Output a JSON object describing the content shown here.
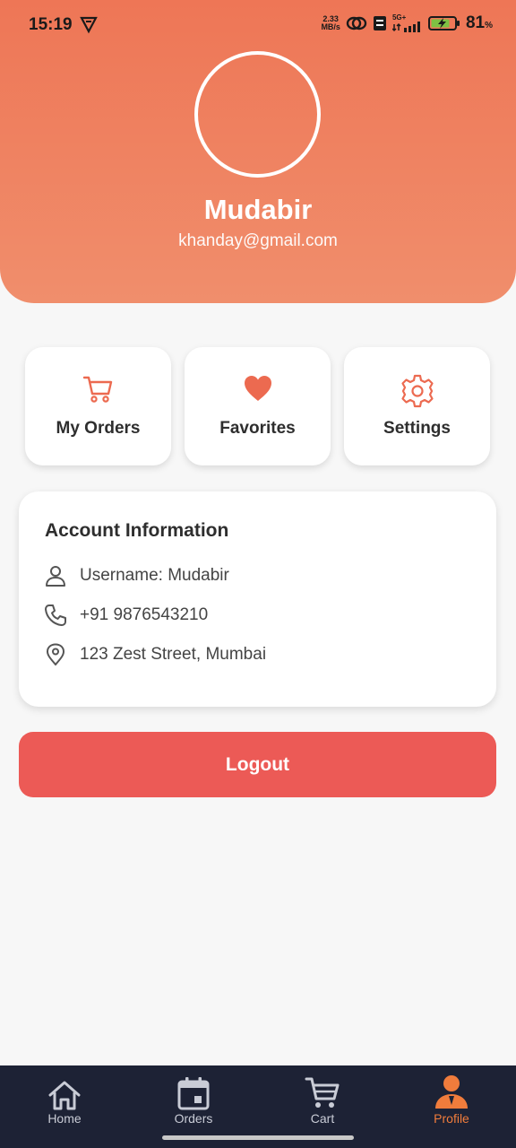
{
  "status_bar": {
    "time": "15:19",
    "net_speed_value": "2.33",
    "net_speed_unit": "MB/s",
    "network": "5G+",
    "battery_percent": "81",
    "battery_unit": "%"
  },
  "profile": {
    "name": "Mudabir",
    "email": "khanday@gmail.com"
  },
  "actions": [
    {
      "label": "My Orders",
      "icon": "cart-icon"
    },
    {
      "label": "Favorites",
      "icon": "heart-icon"
    },
    {
      "label": "Settings",
      "icon": "gear-icon"
    }
  ],
  "account": {
    "title": "Account Information",
    "username": "Username: Mudabir",
    "phone": "+91 9876543210",
    "address": "123 Zest Street, Mumbai"
  },
  "logout_label": "Logout",
  "nav": [
    {
      "label": "Home",
      "icon": "home-icon",
      "active": false
    },
    {
      "label": "Orders",
      "icon": "calendar-icon",
      "active": false
    },
    {
      "label": "Cart",
      "icon": "cart-icon",
      "active": false
    },
    {
      "label": "Profile",
      "icon": "person-icon",
      "active": true
    }
  ],
  "colors": {
    "header_top": "#ee7656",
    "header_bottom": "#f08e6c",
    "accent": "#ec5a56",
    "nav_bg": "#1d2235",
    "nav_active": "#f07c3c"
  }
}
